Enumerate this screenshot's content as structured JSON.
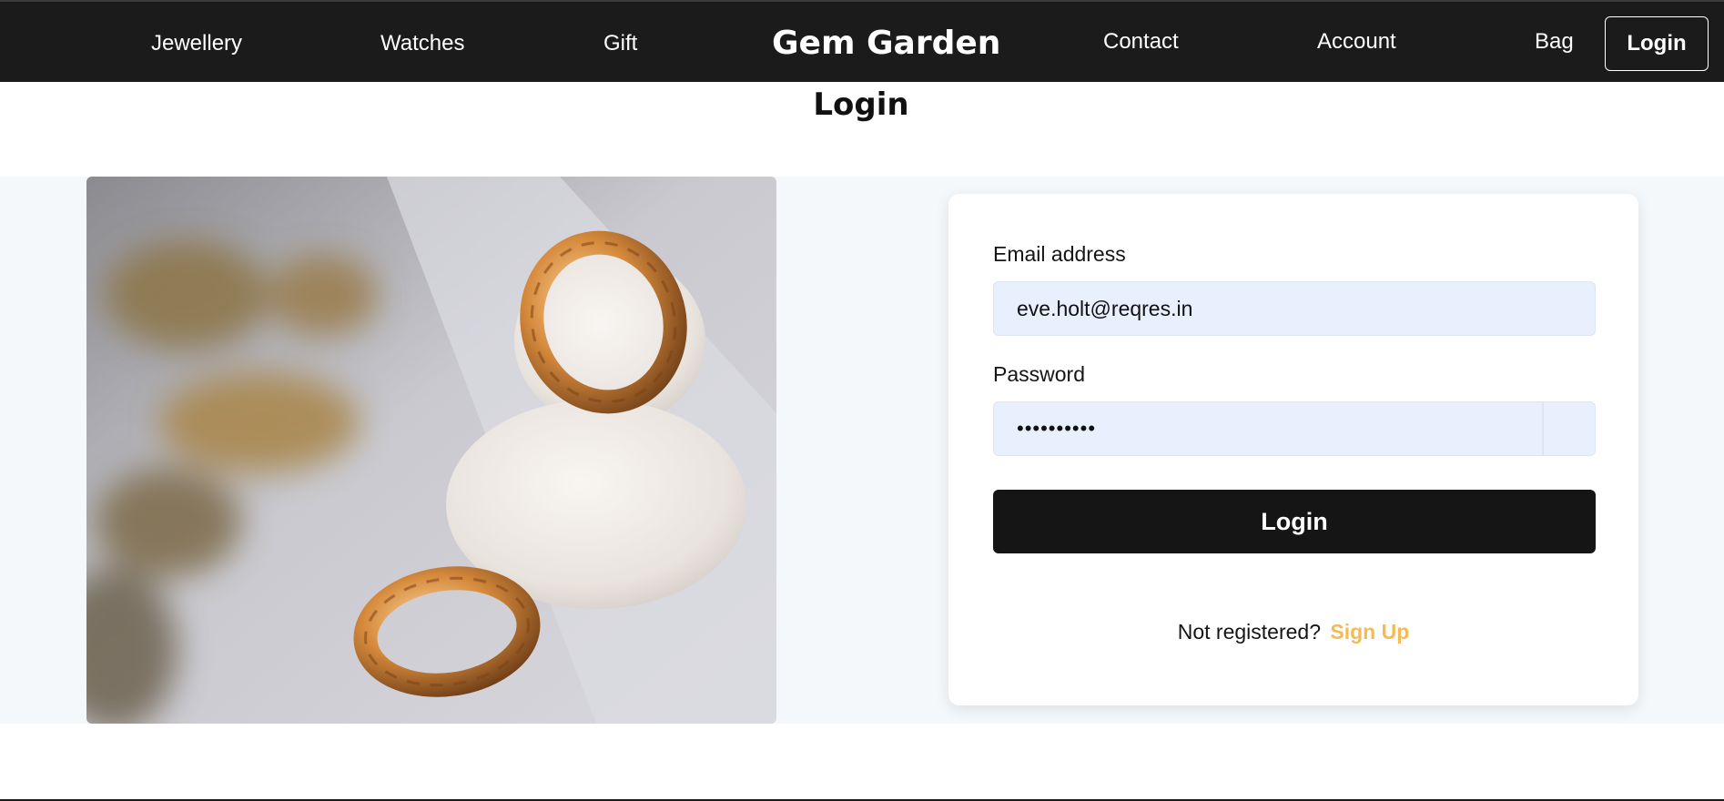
{
  "nav": {
    "links": [
      "Jewellery",
      "Watches",
      "Gift"
    ],
    "brand": "Gem Garden",
    "right_links": [
      "Contact",
      "Account",
      "Bag"
    ],
    "login_button": "Login"
  },
  "page": {
    "title": "Login"
  },
  "form": {
    "email_label": "Email address",
    "email_value": "eve.holt@reqres.in",
    "password_label": "Password",
    "password_value": "••••••••••",
    "submit_label": "Login",
    "register_text": "Not registered?",
    "register_link": "Sign Up"
  },
  "colors": {
    "navbar_bg": "#1b1b1b",
    "accent": "#f7b955",
    "input_bg": "#e8f0fe",
    "band_bg": "#f4f8fb",
    "button_bg": "#151515"
  }
}
